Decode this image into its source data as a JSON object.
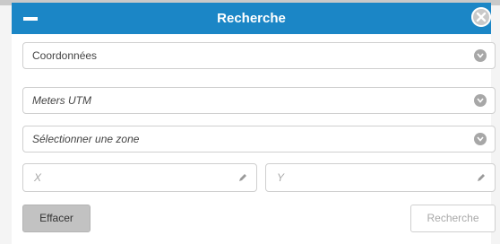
{
  "header": {
    "title": "Recherche"
  },
  "fields": {
    "mode_select": "Coordonnées",
    "projection_select": "Meters UTM",
    "zone_select": "Sélectionner une zone",
    "x_placeholder": "X",
    "y_placeholder": "Y"
  },
  "buttons": {
    "clear_label": "Effacer",
    "search_label": "Recherche"
  },
  "colors": {
    "header": "#1b86c6",
    "chevron": "#a7a7a7",
    "clear_button": "#c2c2c2"
  },
  "icons": [
    "minus-icon",
    "close-icon",
    "chevron-down-icon",
    "pencil-icon"
  ]
}
